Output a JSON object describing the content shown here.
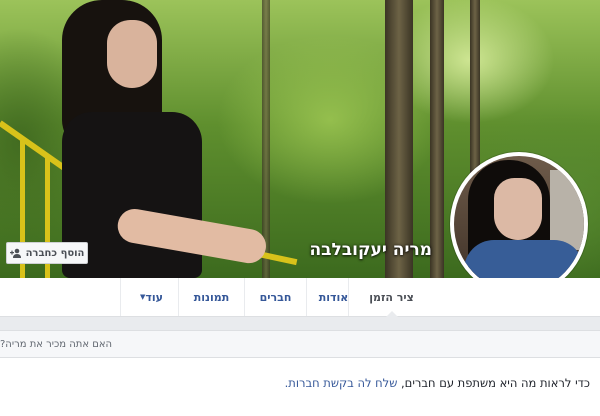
{
  "profile": {
    "name": "מריה יעקובלבה",
    "add_friend_label": "הוסף כחברה",
    "add_friend_icon": "add-friend-icon"
  },
  "nav": {
    "tabs": [
      {
        "label": "ציר הזמן",
        "active": true
      },
      {
        "label": "אודות"
      },
      {
        "label": "חברים"
      },
      {
        "label": "תמונות"
      },
      {
        "label": "עוד",
        "icon": "caret-down-icon"
      }
    ]
  },
  "prompt": {
    "question": "האם אתה מכיר את מריה?",
    "message_prefix": "כדי לראות מה היא משתפת עם חברים,",
    "message_link": "שלח לה בקשת חברות."
  },
  "colors": {
    "link": "#365899",
    "background": "#e9ebee",
    "text": "#1d2129"
  }
}
